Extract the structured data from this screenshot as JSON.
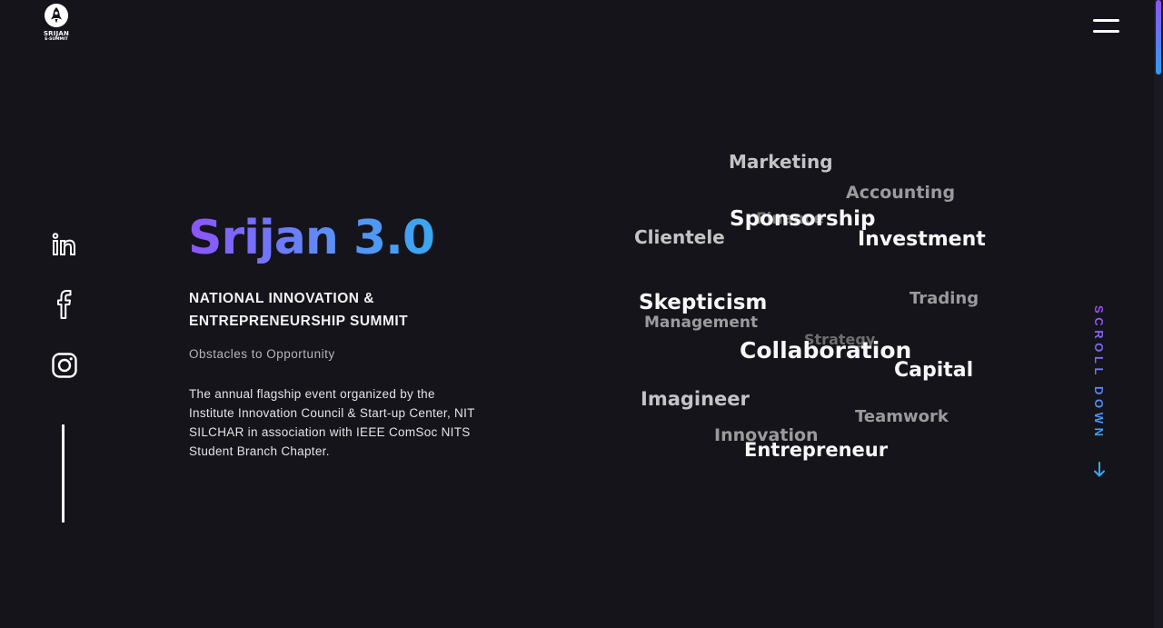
{
  "logo": {
    "title": "SRIJAN",
    "subtitle": "E-SUMMIT",
    "icon": "rocket-icon"
  },
  "menu": {
    "icon": "hamburger-menu-icon"
  },
  "social": [
    {
      "name": "linkedin",
      "icon": "linkedin-icon"
    },
    {
      "name": "facebook",
      "icon": "facebook-icon"
    },
    {
      "name": "instagram",
      "icon": "instagram-icon"
    }
  ],
  "hero": {
    "title": "Srijan 3.0",
    "subtitle_line1": "NATIONAL INNOVATION &",
    "subtitle_line2": "ENTREPRENEURSHIP SUMMIT",
    "tagline": "Obstacles to Opportunity",
    "desc_line1": "The annual flagship event organized by the",
    "desc_line2": "Institute Innovation Council & Start-up Center, NIT",
    "desc_line3": "SILCHAR in association with IEEE ComSoc NITS",
    "desc_line4": "Student Branch Chapter."
  },
  "word_cloud": {
    "marketing": "Marketing",
    "accounting": "Accounting",
    "finance": "Finance",
    "sponsorship": "Sponsorship",
    "clientele": "Clientele",
    "investment": "Investment",
    "skepticism": "Skepticism",
    "trading": "Trading",
    "management": "Management",
    "strategy": "Strategy",
    "collaboration": "Collaboration",
    "capital": "Capital",
    "imagineer": "Imagineer",
    "teamwork": "Teamwork",
    "innovation": "Innovation",
    "entrepreneur": "Entrepreneur"
  },
  "scroll_down": {
    "label": "SCROLL DOWN",
    "icon": "arrow-down-icon"
  },
  "colors": {
    "background": "#15141b",
    "gradient_start": "#8c54ff",
    "gradient_end": "#3aa7f0"
  }
}
